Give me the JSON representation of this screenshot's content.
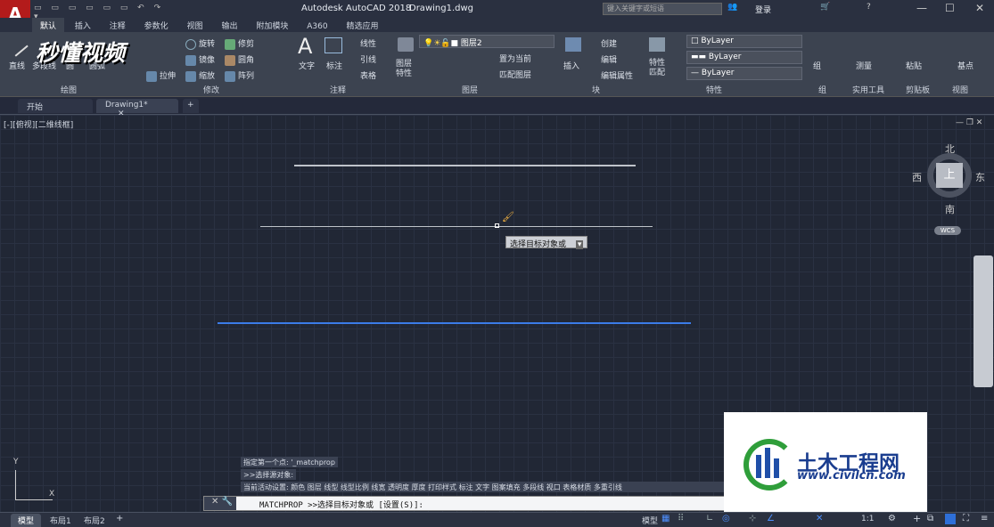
{
  "app": {
    "title": "Autodesk AutoCAD 2018",
    "file": "Drawing1.dwg",
    "search_placeholder": "键入关键字或短语",
    "login": "登录"
  },
  "ribbon_tabs": [
    "默认",
    "插入",
    "注释",
    "参数化",
    "视图",
    "输出",
    "附加模块",
    "A360",
    "精选应用"
  ],
  "ribbon": {
    "draw": {
      "line": "直线",
      "polyline": "多段线",
      "circle": "圆",
      "arc": "圆弧",
      "section": "绘图"
    },
    "modify": {
      "rotate": "旋转",
      "trim": "修剪",
      "mirror": "镜像",
      "fillet": "圆角",
      "stretch": "拉伸",
      "scale": "缩放",
      "array": "阵列",
      "section": "修改"
    },
    "annotation": {
      "text": "文字",
      "dimension": "标注",
      "linear": "线性",
      "leader": "引线",
      "table": "表格",
      "section": "注释"
    },
    "layers": {
      "layer_props": "图层特性",
      "current_layer": "图层2",
      "set_current": "置为当前",
      "match_layer": "匹配图层",
      "section": "图层"
    },
    "block": {
      "insert": "插入",
      "create": "创建",
      "edit": "编辑",
      "edit_attr": "编辑属性",
      "section": "块"
    },
    "properties": {
      "match": "特性匹配",
      "color": "ByLayer",
      "lineweight": "ByLayer",
      "linetype": "ByLayer",
      "section": "特性"
    },
    "groups": {
      "group": "组",
      "section": "组"
    },
    "utilities": {
      "measure": "测量",
      "section": "实用工具"
    },
    "clipboard": {
      "paste": "粘贴",
      "section": "剪贴板"
    },
    "view": {
      "base": "基点",
      "section": "视图"
    }
  },
  "watermark": "秒懂视频",
  "doc_tabs": [
    "开始",
    "Drawing1*"
  ],
  "viewport_label": "[-][俯视][二维线框]",
  "tooltip": "选择目标对象或",
  "viewcube": {
    "north": "北",
    "south": "南",
    "east": "东",
    "west": "西",
    "top": "上",
    "wcs": "WCS"
  },
  "command": {
    "history1": "指定第一个点: '_matchprop",
    "history2": ">>选择源对象:",
    "history3": "当前活动设置: 颜色 图层 线型 线型比例 线宽 透明度 厚度 打印样式 标注 文字 图案填充 多段线 视口 表格材质 多重引线",
    "prompt": "MATCHPROP >>选择目标对象或 [设置(S)]:"
  },
  "layout_tabs": [
    "模型",
    "布局1",
    "布局2"
  ],
  "status": {
    "model": "模型",
    "scale": "1:1"
  },
  "logo": {
    "name": "土木工程网",
    "url": "www.civilcn.com"
  },
  "colors": {
    "accent": "#2e6fd8",
    "canvas": "#212735",
    "blue_line": "#3b7ce8"
  }
}
